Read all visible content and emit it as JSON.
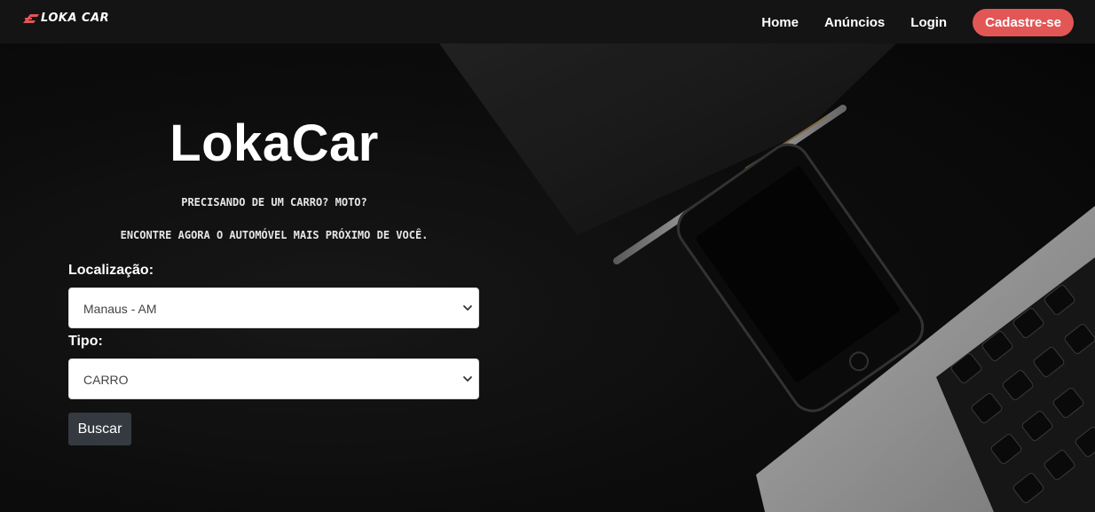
{
  "navbar": {
    "brand": "LOKA CAR",
    "links": [
      "Home",
      "Anúncios",
      "Login"
    ],
    "cta": "Cadastre-se",
    "cta_color": "#e35656"
  },
  "hero": {
    "title": "LokaCar",
    "tagline_1": "PRECISANDO DE UM CARRO? MOTO?",
    "tagline_2": "ENCONTRE AGORA O AUTOMÓVEL MAIS PRÓXIMO DE VOCÊ."
  },
  "form": {
    "location_label": "Localização:",
    "location_value": "Manaus - AM",
    "type_label": "Tipo:",
    "type_value": "CARRO",
    "search_button": "Buscar",
    "button_color": "#343a40"
  },
  "icons": {
    "brand_logo": "car-wing-logo-icon",
    "select_caret": "chevron-down-icon"
  }
}
